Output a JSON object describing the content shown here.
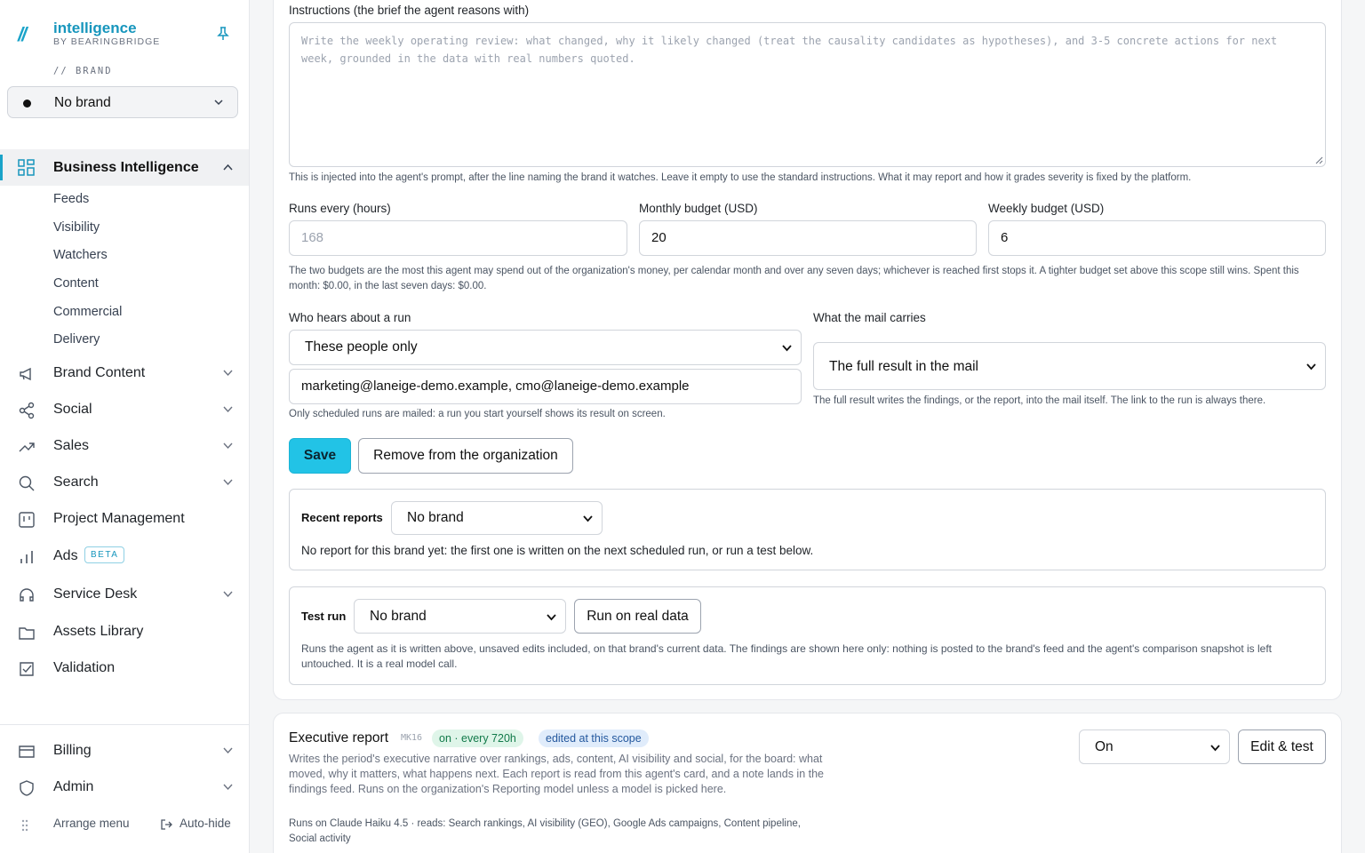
{
  "sidebar": {
    "logo_mark": "//",
    "app_name": "intelligence",
    "app_sub": "BY BEARINGBRIDGE",
    "brand_label": "// BRAND",
    "brand_value": "No brand",
    "active_section": "Business Intelligence",
    "sub_items": [
      "Feeds",
      "Visibility",
      "Watchers",
      "Content",
      "Commercial",
      "Delivery"
    ],
    "items": [
      {
        "label": "Brand Content",
        "icon": "megaphone-icon"
      },
      {
        "label": "Social",
        "icon": "share-icon"
      },
      {
        "label": "Sales",
        "icon": "trend-icon"
      },
      {
        "label": "Search",
        "icon": "search-icon"
      },
      {
        "label": "Project Management",
        "icon": "board-icon"
      },
      {
        "label": "Ads",
        "icon": "bar-chart-icon",
        "badge": "BETA"
      },
      {
        "label": "Service Desk",
        "icon": "headset-icon"
      },
      {
        "label": "Assets Library",
        "icon": "folder-icon"
      },
      {
        "label": "Validation",
        "icon": "checkbox-icon"
      }
    ],
    "bottom_items": [
      {
        "label": "Billing",
        "icon": "card-icon"
      },
      {
        "label": "Admin",
        "icon": "shield-icon"
      }
    ],
    "arrange_menu": "Arrange menu",
    "auto_hide": "Auto-hide"
  },
  "agent_form": {
    "instructions_label": "Instructions (the brief the agent reasons with)",
    "instructions_placeholder": "Write the weekly operating review: what changed, why it likely changed (treat the causality candidates as hypotheses), and 3-5 concrete actions for next week, grounded in the data with real numbers quoted.",
    "instructions_hint": "This is injected into the agent's prompt, after the line naming the brand it watches. Leave it empty to use the standard instructions. What it may report and how it grades severity is fixed by the platform.",
    "runs_every_label": "Runs every (hours)",
    "runs_every_placeholder": "168",
    "monthly_budget_label": "Monthly budget (USD)",
    "monthly_budget_value": "20",
    "weekly_budget_label": "Weekly budget (USD)",
    "weekly_budget_value": "6",
    "budget_hint": "The two budgets are the most this agent may spend out of the organization's money, per calendar month and over any seven days; whichever is reached first stops it. A tighter budget set above this scope still wins. Spent this month: $0.00, in the last seven days: $0.00.",
    "who_hears_label": "Who hears about a run",
    "who_hears_value": "These people only",
    "recipients_value": "marketing@laneige-demo.example, cmo@laneige-demo.example",
    "recipients_hint": "Only scheduled runs are mailed: a run you start yourself shows its result on screen.",
    "mail_carries_label": "What the mail carries",
    "mail_carries_value": "The full result in the mail",
    "mail_hint": "The full result writes the findings, or the report, into the mail itself. The link to the run is always there.",
    "save_label": "Save",
    "remove_label": "Remove from the organization",
    "recent_reports_label": "Recent reports",
    "recent_reports_value": "No brand",
    "recent_reports_text": "No report for this brand yet: the first one is written on the next scheduled run, or run a test below.",
    "test_run_label": "Test run",
    "test_run_value": "No brand",
    "run_real_label": "Run on real data",
    "test_run_hint": "Runs the agent as it is written above, unsaved edits included, on that brand's current data. The findings are shown here only: nothing is posted to the brand's feed and the agent's comparison snapshot is left untouched. It is a real model call."
  },
  "executive_report": {
    "title": "Executive report",
    "code": "MK16",
    "status_pill": "on · every 720h",
    "scope_pill": "edited at this scope",
    "description": "Writes the period's executive narrative over rankings, ads, content, AI visibility and social, for the board: what moved, why it matters, what happens next. Each report is read from this agent's card, and a note lands in the findings feed. Runs on the organization's Reporting model unless a model is picked here.",
    "meta": "Runs on Claude Haiku 4.5 · reads: Search rankings, AI visibility (GEO), Google Ads campaigns, Content pipeline, Social activity",
    "state_value": "On",
    "edit_label": "Edit & test"
  },
  "colors": {
    "accent": "#22c3e6",
    "brand": "#1796bd"
  }
}
